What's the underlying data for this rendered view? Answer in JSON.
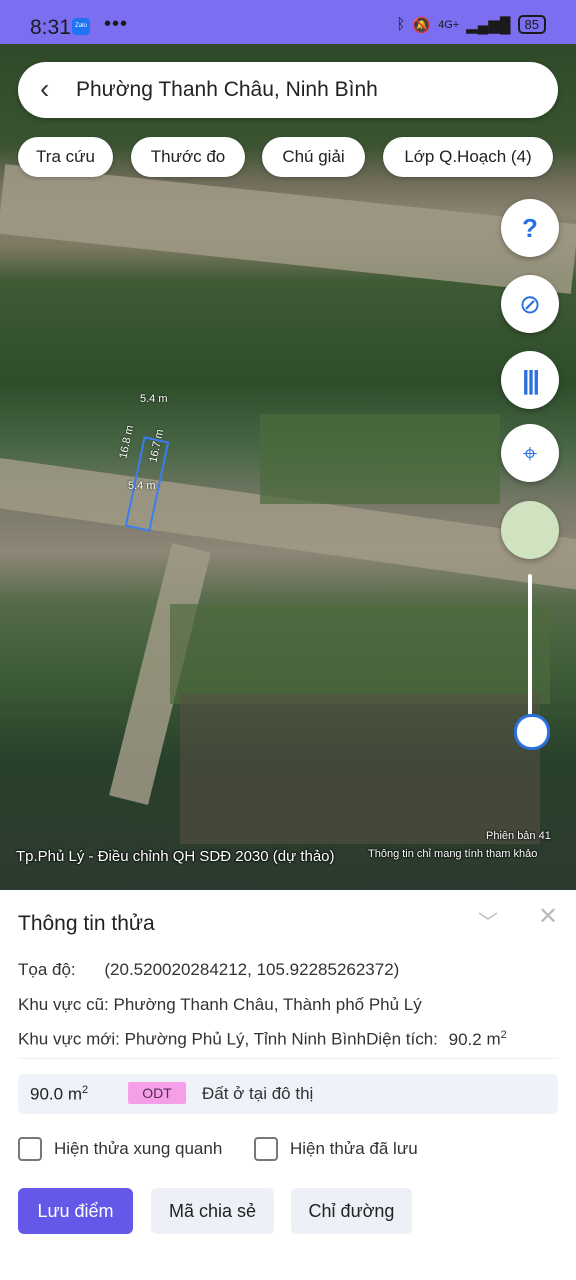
{
  "status": {
    "time": "8:31",
    "app_badge": "Zalo",
    "dots": "•••",
    "network": "4G+",
    "battery": "85"
  },
  "search": {
    "back_glyph": "‹",
    "title": "Phường Thanh Châu, Ninh Bình"
  },
  "chips": [
    "Tra cứu",
    "Thước đo",
    "Chú giải",
    "Lớp Q.Hoạch (4)"
  ],
  "map": {
    "fabs": [
      {
        "icon": "help-icon",
        "glyph": "?"
      },
      {
        "icon": "compass-icon",
        "glyph": "⊘"
      },
      {
        "icon": "barcode-icon",
        "glyph": "|||"
      },
      {
        "icon": "locate-icon",
        "glyph": "⌖"
      },
      {
        "icon": "layer-thumbnail-icon",
        "glyph": ""
      }
    ],
    "dims": {
      "top": "5.4 m",
      "bottom": "5.4 m",
      "left": "16.8 m",
      "right": "16.7 m"
    },
    "caption": "Tp.Phủ Lý - Điều chỉnh QH SDĐ 2030 (dự thảo)",
    "version": "Phiên bản 41",
    "disclaimer": "Thông tin chỉ mang tính tham khảo"
  },
  "panel": {
    "title": "Thông tin thửa",
    "coords_label": "Tọa độ:",
    "coords_value": "(20.520020284212, 105.92285262372)",
    "old_area": "Khu vực cũ: Phường Thanh Châu, Thành phố Phủ Lý",
    "new_area": "Khu vực mới: Phường Phủ Lý, Tỉnh Ninh Bình",
    "size_label": "Diện tích:",
    "size_value": "90.2",
    "land_area": "90.0",
    "area_unit": "m",
    "land_code": "ODT",
    "land_desc": "Đất ở tại đô thị",
    "check1": "Hiện thửa xung quanh",
    "check2": "Hiện thửa đã lưu",
    "btn_save": "Lưu điểm",
    "btn_share": "Mã chia sẻ",
    "btn_route": "Chỉ đường"
  }
}
